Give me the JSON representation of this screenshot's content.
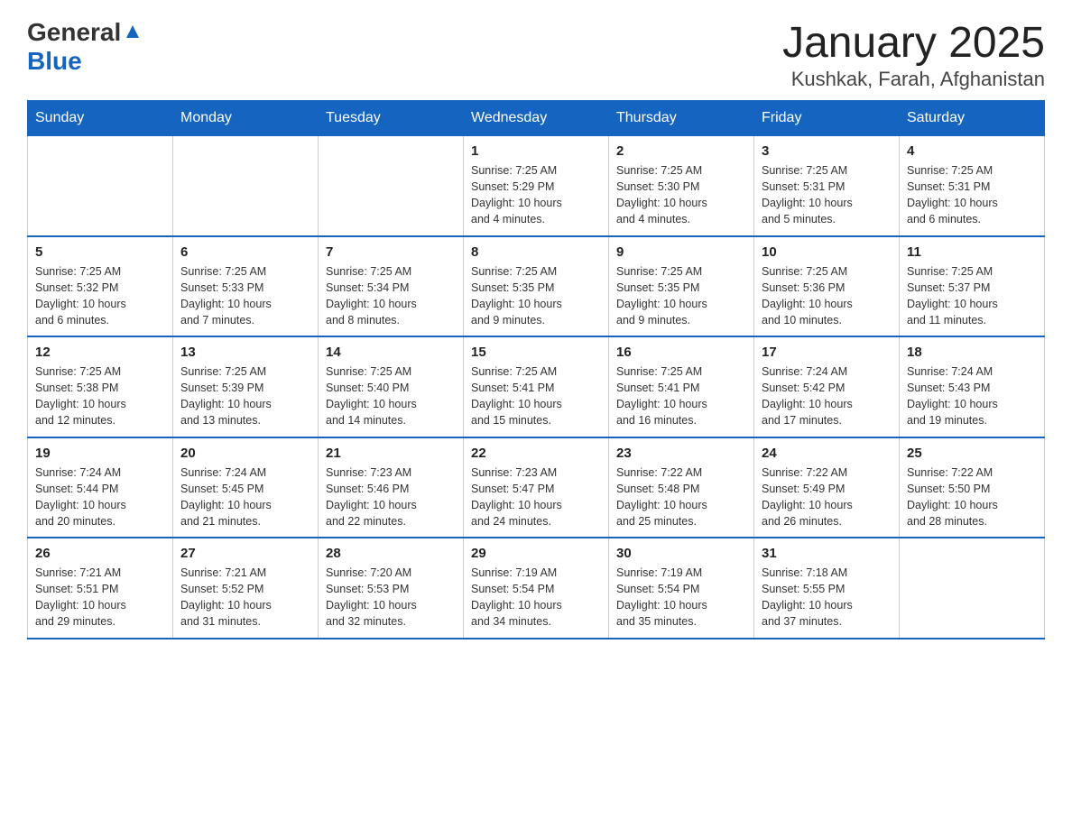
{
  "header": {
    "logo_general": "General",
    "logo_blue": "Blue",
    "title": "January 2025",
    "subtitle": "Kushkak, Farah, Afghanistan"
  },
  "days_of_week": [
    "Sunday",
    "Monday",
    "Tuesday",
    "Wednesday",
    "Thursday",
    "Friday",
    "Saturday"
  ],
  "weeks": [
    [
      {
        "day": "",
        "info": ""
      },
      {
        "day": "",
        "info": ""
      },
      {
        "day": "",
        "info": ""
      },
      {
        "day": "1",
        "info": "Sunrise: 7:25 AM\nSunset: 5:29 PM\nDaylight: 10 hours\nand 4 minutes."
      },
      {
        "day": "2",
        "info": "Sunrise: 7:25 AM\nSunset: 5:30 PM\nDaylight: 10 hours\nand 4 minutes."
      },
      {
        "day": "3",
        "info": "Sunrise: 7:25 AM\nSunset: 5:31 PM\nDaylight: 10 hours\nand 5 minutes."
      },
      {
        "day": "4",
        "info": "Sunrise: 7:25 AM\nSunset: 5:31 PM\nDaylight: 10 hours\nand 6 minutes."
      }
    ],
    [
      {
        "day": "5",
        "info": "Sunrise: 7:25 AM\nSunset: 5:32 PM\nDaylight: 10 hours\nand 6 minutes."
      },
      {
        "day": "6",
        "info": "Sunrise: 7:25 AM\nSunset: 5:33 PM\nDaylight: 10 hours\nand 7 minutes."
      },
      {
        "day": "7",
        "info": "Sunrise: 7:25 AM\nSunset: 5:34 PM\nDaylight: 10 hours\nand 8 minutes."
      },
      {
        "day": "8",
        "info": "Sunrise: 7:25 AM\nSunset: 5:35 PM\nDaylight: 10 hours\nand 9 minutes."
      },
      {
        "day": "9",
        "info": "Sunrise: 7:25 AM\nSunset: 5:35 PM\nDaylight: 10 hours\nand 9 minutes."
      },
      {
        "day": "10",
        "info": "Sunrise: 7:25 AM\nSunset: 5:36 PM\nDaylight: 10 hours\nand 10 minutes."
      },
      {
        "day": "11",
        "info": "Sunrise: 7:25 AM\nSunset: 5:37 PM\nDaylight: 10 hours\nand 11 minutes."
      }
    ],
    [
      {
        "day": "12",
        "info": "Sunrise: 7:25 AM\nSunset: 5:38 PM\nDaylight: 10 hours\nand 12 minutes."
      },
      {
        "day": "13",
        "info": "Sunrise: 7:25 AM\nSunset: 5:39 PM\nDaylight: 10 hours\nand 13 minutes."
      },
      {
        "day": "14",
        "info": "Sunrise: 7:25 AM\nSunset: 5:40 PM\nDaylight: 10 hours\nand 14 minutes."
      },
      {
        "day": "15",
        "info": "Sunrise: 7:25 AM\nSunset: 5:41 PM\nDaylight: 10 hours\nand 15 minutes."
      },
      {
        "day": "16",
        "info": "Sunrise: 7:25 AM\nSunset: 5:41 PM\nDaylight: 10 hours\nand 16 minutes."
      },
      {
        "day": "17",
        "info": "Sunrise: 7:24 AM\nSunset: 5:42 PM\nDaylight: 10 hours\nand 17 minutes."
      },
      {
        "day": "18",
        "info": "Sunrise: 7:24 AM\nSunset: 5:43 PM\nDaylight: 10 hours\nand 19 minutes."
      }
    ],
    [
      {
        "day": "19",
        "info": "Sunrise: 7:24 AM\nSunset: 5:44 PM\nDaylight: 10 hours\nand 20 minutes."
      },
      {
        "day": "20",
        "info": "Sunrise: 7:24 AM\nSunset: 5:45 PM\nDaylight: 10 hours\nand 21 minutes."
      },
      {
        "day": "21",
        "info": "Sunrise: 7:23 AM\nSunset: 5:46 PM\nDaylight: 10 hours\nand 22 minutes."
      },
      {
        "day": "22",
        "info": "Sunrise: 7:23 AM\nSunset: 5:47 PM\nDaylight: 10 hours\nand 24 minutes."
      },
      {
        "day": "23",
        "info": "Sunrise: 7:22 AM\nSunset: 5:48 PM\nDaylight: 10 hours\nand 25 minutes."
      },
      {
        "day": "24",
        "info": "Sunrise: 7:22 AM\nSunset: 5:49 PM\nDaylight: 10 hours\nand 26 minutes."
      },
      {
        "day": "25",
        "info": "Sunrise: 7:22 AM\nSunset: 5:50 PM\nDaylight: 10 hours\nand 28 minutes."
      }
    ],
    [
      {
        "day": "26",
        "info": "Sunrise: 7:21 AM\nSunset: 5:51 PM\nDaylight: 10 hours\nand 29 minutes."
      },
      {
        "day": "27",
        "info": "Sunrise: 7:21 AM\nSunset: 5:52 PM\nDaylight: 10 hours\nand 31 minutes."
      },
      {
        "day": "28",
        "info": "Sunrise: 7:20 AM\nSunset: 5:53 PM\nDaylight: 10 hours\nand 32 minutes."
      },
      {
        "day": "29",
        "info": "Sunrise: 7:19 AM\nSunset: 5:54 PM\nDaylight: 10 hours\nand 34 minutes."
      },
      {
        "day": "30",
        "info": "Sunrise: 7:19 AM\nSunset: 5:54 PM\nDaylight: 10 hours\nand 35 minutes."
      },
      {
        "day": "31",
        "info": "Sunrise: 7:18 AM\nSunset: 5:55 PM\nDaylight: 10 hours\nand 37 minutes."
      },
      {
        "day": "",
        "info": ""
      }
    ]
  ]
}
